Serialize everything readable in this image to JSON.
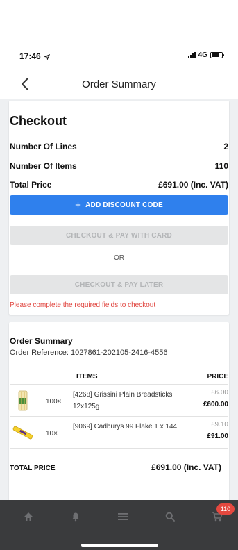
{
  "status_bar": {
    "time": "17:46",
    "network": "4G"
  },
  "nav": {
    "title": "Order Summary"
  },
  "checkout": {
    "title": "Checkout",
    "rows": [
      {
        "label": "Number Of Lines",
        "value": "2"
      },
      {
        "label": "Number Of Items",
        "value": "110"
      },
      {
        "label": "Total Price",
        "value": "£691.00 (Inc. VAT)"
      }
    ],
    "discount_button": "ADD DISCOUNT CODE",
    "pay_card_button": "CHECKOUT & PAY WITH CARD",
    "or_label": "OR",
    "pay_later_button": "CHECKOUT & PAY LATER",
    "error": "Please complete the required fields to checkout"
  },
  "summary": {
    "title": "Order Summary",
    "reference": "Order Reference: 1027861-202105-2416-4556",
    "col_items": "ITEMS",
    "col_price": "PRICE",
    "lines": [
      {
        "qty": "100×",
        "name": "[4268] Grissini Plain Breadsticks 12x125g",
        "unit_price": "£6.00",
        "line_total": "£600.00",
        "image_icon": "breadsticks-icon"
      },
      {
        "qty": "10×",
        "name": "[9069] Cadburys 99 Flake 1 x 144",
        "unit_price": "£9.10",
        "line_total": "£91.00",
        "image_icon": "flake-icon"
      }
    ],
    "total_label": "TOTAL PRICE",
    "total_value": "£691.00 (Inc. VAT)"
  },
  "tab_bar": {
    "tabs": [
      "home-icon",
      "bell-icon",
      "menu-icon",
      "search-icon",
      "cart-icon"
    ],
    "cart_badge": "110"
  },
  "colors": {
    "primary": "#2f80ed",
    "error": "#e0443e",
    "tab_bar": "#3a3b3d",
    "badge": "#e4483f"
  }
}
